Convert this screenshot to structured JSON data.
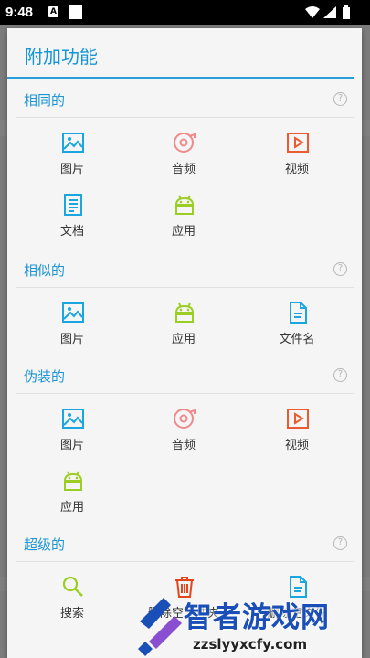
{
  "status_bar": {
    "time": "9:48",
    "notif_letter": "A"
  },
  "dialog": {
    "title": "附加功能",
    "sections": [
      {
        "title": "相同的",
        "items": [
          {
            "label": "图片",
            "icon": "image-icon"
          },
          {
            "label": "音频",
            "icon": "music-disc-icon"
          },
          {
            "label": "视频",
            "icon": "video-icon"
          },
          {
            "label": "文档",
            "icon": "document-icon"
          },
          {
            "label": "应用",
            "icon": "android-icon"
          }
        ]
      },
      {
        "title": "相似的",
        "items": [
          {
            "label": "图片",
            "icon": "image-icon"
          },
          {
            "label": "应用",
            "icon": "android-icon"
          },
          {
            "label": "文件名",
            "icon": "file-icon"
          }
        ]
      },
      {
        "title": "伪装的",
        "items": [
          {
            "label": "图片",
            "icon": "image-icon"
          },
          {
            "label": "音频",
            "icon": "music-disc-icon"
          },
          {
            "label": "视频",
            "icon": "video-icon"
          },
          {
            "label": "应用",
            "icon": "android-icon"
          }
        ]
      },
      {
        "title": "超级的",
        "items": [
          {
            "label": "搜索",
            "icon": "search-icon"
          },
          {
            "label": "删除空文件夹",
            "icon": "trash-icon"
          },
          {
            "label": "删除空文件",
            "icon": "file-icon"
          }
        ]
      }
    ]
  },
  "colors": {
    "accent": "#1597d6",
    "image": "#1aa6e0",
    "audio": "#ef8a8a",
    "video": "#ee5a2f",
    "android": "#9ccd23",
    "trash": "#e8441c",
    "search": "#9ccd23"
  },
  "watermark": {
    "text": "智者游戏网",
    "url": "zzslyyxcfy.com"
  }
}
